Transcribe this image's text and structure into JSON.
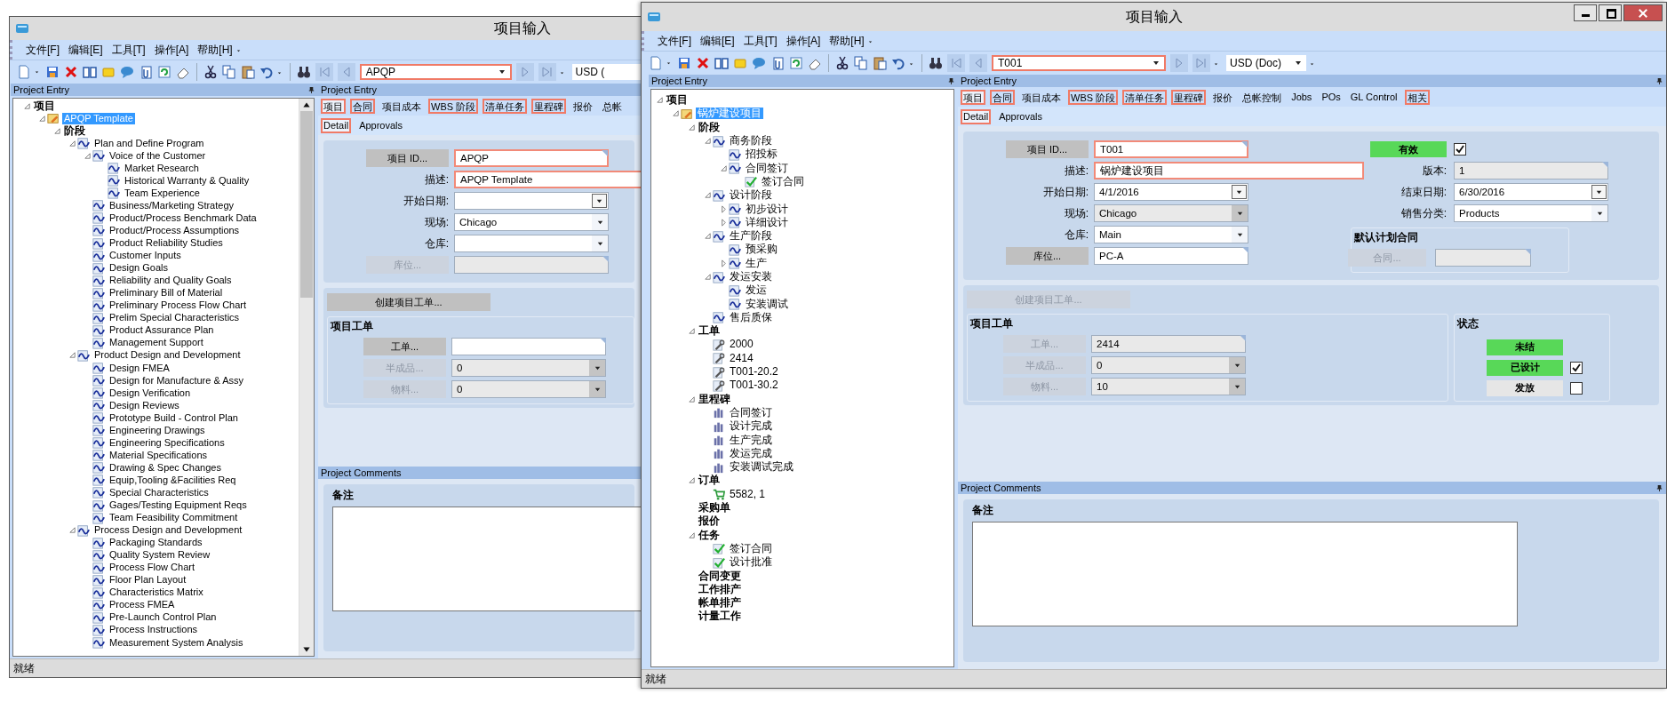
{
  "windows": [
    {
      "title": "项目输入",
      "window_buttons": false,
      "menu": [
        "文件[F]",
        "编辑[E]",
        "工具[T]",
        "操作[A]",
        "帮助[H]"
      ],
      "record": "APQP",
      "currency": "USD (",
      "tree_title": "Project Entry",
      "tree_scrollbar": true,
      "tree": [
        {
          "label": "项目",
          "kind": "root",
          "selected": false,
          "expanded": true,
          "children": [
            {
              "label": "APQP Template",
              "kind": "project",
              "selected": true,
              "expanded": true,
              "children": [
                {
                  "label": "阶段",
                  "kind": "group",
                  "selected": false,
                  "expanded": true,
                  "children": [
                    {
                      "label": "Plan and Define Program",
                      "kind": "phase",
                      "selected": false,
                      "expanded": true,
                      "children": [
                        {
                          "label": "Voice of the Customer",
                          "kind": "phase",
                          "selected": false,
                          "expanded": true,
                          "children": [
                            {
                              "label": "Market Research",
                              "kind": "phase",
                              "selected": false
                            },
                            {
                              "label": "Historical Warranty & Quality",
                              "kind": "phase",
                              "selected": false
                            },
                            {
                              "label": "Team Experience",
                              "kind": "phase",
                              "selected": false
                            }
                          ]
                        },
                        {
                          "label": "Business/Marketing Strategy",
                          "kind": "phase",
                          "selected": false
                        },
                        {
                          "label": "Product/Process Benchmark Data",
                          "kind": "phase",
                          "selected": false
                        },
                        {
                          "label": "Product/Process Assumptions",
                          "kind": "phase",
                          "selected": false
                        },
                        {
                          "label": "Product Reliability Studies",
                          "kind": "phase",
                          "selected": false
                        },
                        {
                          "label": "Customer Inputs",
                          "kind": "phase",
                          "selected": false
                        },
                        {
                          "label": "Design Goals",
                          "kind": "phase",
                          "selected": false
                        },
                        {
                          "label": "Reliability and Quality Goals",
                          "kind": "phase",
                          "selected": false
                        },
                        {
                          "label": "Preliminary Bill of Material",
                          "kind": "phase",
                          "selected": false
                        },
                        {
                          "label": "Preliminary Process Flow Chart",
                          "kind": "phase",
                          "selected": false
                        },
                        {
                          "label": "Prelim Special Characteristics",
                          "kind": "phase",
                          "selected": false
                        },
                        {
                          "label": "Product Assurance Plan",
                          "kind": "phase",
                          "selected": false
                        },
                        {
                          "label": "Management Support",
                          "kind": "phase",
                          "selected": false
                        }
                      ]
                    },
                    {
                      "label": "Product Design and Development",
                      "kind": "phase",
                      "selected": false,
                      "expanded": true,
                      "children": [
                        {
                          "label": "Design FMEA",
                          "kind": "phase",
                          "selected": false
                        },
                        {
                          "label": "Design for Manufacture & Assy",
                          "kind": "phase",
                          "selected": false
                        },
                        {
                          "label": "Design Verification",
                          "kind": "phase",
                          "selected": false
                        },
                        {
                          "label": "Design Reviews",
                          "kind": "phase",
                          "selected": false
                        },
                        {
                          "label": "Prototype Build - Control Plan",
                          "kind": "phase",
                          "selected": false
                        },
                        {
                          "label": "Engineering Drawings",
                          "kind": "phase",
                          "selected": false
                        },
                        {
                          "label": "Engineering Specifications",
                          "kind": "phase",
                          "selected": false
                        },
                        {
                          "label": "Material Specifications",
                          "kind": "phase",
                          "selected": false
                        },
                        {
                          "label": "Drawing & Spec Changes",
                          "kind": "phase",
                          "selected": false
                        },
                        {
                          "label": "Equip,Tooling &Facilities Req",
                          "kind": "phase",
                          "selected": false
                        },
                        {
                          "label": "Special Characteristics",
                          "kind": "phase",
                          "selected": false
                        },
                        {
                          "label": "Gages/Testing Equipment Reqs",
                          "kind": "phase",
                          "selected": false
                        },
                        {
                          "label": "Team Feasibility Commitment",
                          "kind": "phase",
                          "selected": false
                        }
                      ]
                    },
                    {
                      "label": "Process Design and Development",
                      "kind": "phase",
                      "selected": false,
                      "expanded": true,
                      "children": [
                        {
                          "label": "Packaging Standards",
                          "kind": "phase",
                          "selected": false
                        },
                        {
                          "label": "Quality System Review",
                          "kind": "phase",
                          "selected": false
                        },
                        {
                          "label": "Process Flow Chart",
                          "kind": "phase",
                          "selected": false
                        },
                        {
                          "label": "Floor Plan Layout",
                          "kind": "phase",
                          "selected": false
                        },
                        {
                          "label": "Characteristics Matrix",
                          "kind": "phase",
                          "selected": false
                        },
                        {
                          "label": "Process FMEA",
                          "kind": "phase",
                          "selected": false
                        },
                        {
                          "label": "Pre-Launch Control Plan",
                          "kind": "phase",
                          "selected": false
                        },
                        {
                          "label": "Process Instructions",
                          "kind": "phase",
                          "selected": false
                        },
                        {
                          "label": "Measurement System Analysis",
                          "kind": "phase",
                          "selected": false
                        }
                      ]
                    }
                  ]
                }
              ]
            }
          ]
        }
      ],
      "form_title": "Project Entry",
      "tabs": [
        {
          "label": "项目",
          "selected": true,
          "flagged": true
        },
        {
          "label": "合同",
          "selected": false,
          "flagged": true
        },
        {
          "label": "项目成本",
          "selected": false,
          "flagged": false
        },
        {
          "label": "WBS 阶段",
          "selected": false,
          "flagged": true
        },
        {
          "label": "清单任务",
          "selected": false,
          "flagged": true
        },
        {
          "label": "里程碑",
          "selected": false,
          "flagged": true
        },
        {
          "label": "报价",
          "selected": false,
          "flagged": false
        },
        {
          "label": "总帐",
          "selected": false,
          "flagged": false
        }
      ],
      "subtabs": [
        {
          "label": "Detail",
          "selected": true,
          "flagged": true
        },
        {
          "label": "Approvals",
          "selected": false,
          "flagged": false
        }
      ],
      "fields": [
        {
          "button": "项目 ID...",
          "kind": "text",
          "value": "APQP",
          "required": true,
          "disabled": false
        },
        {
          "label": "描述:",
          "kind": "long_text",
          "value": "APQP Template",
          "required": true,
          "disabled": false
        },
        {
          "label": "开始日期:",
          "kind": "date",
          "required": false,
          "disabled": false
        },
        {
          "label": "现场:",
          "kind": "combo",
          "value": "Chicago",
          "required": false,
          "disabled": false
        },
        {
          "label": "仓库:",
          "kind": "combo",
          "required": false,
          "disabled": false
        },
        {
          "button": "库位...",
          "kind": "text",
          "required": false,
          "disabled": true
        }
      ],
      "create_button": {
        "label": "创建项目工单...",
        "disabled": false
      },
      "work_order_group": {
        "title": "项目工单",
        "fields": [
          {
            "button": "工单...",
            "kind": "text",
            "required": false,
            "disabled": false
          },
          {
            "button": "半成品...",
            "kind": "combo",
            "value": "0",
            "required": false,
            "disabled": true
          },
          {
            "button": "物料...",
            "kind": "combo",
            "value": "0",
            "required": false,
            "disabled": true
          }
        ]
      },
      "comments_title": "Project Comments",
      "notes_label": "备注",
      "status": "就绪"
    },
    {
      "title": "项目输入",
      "window_buttons": true,
      "menu": [
        "文件[F]",
        "编辑[E]",
        "工具[T]",
        "操作[A]",
        "帮助[H]"
      ],
      "record": "T001",
      "currency": "USD (Doc)",
      "tree_title": "Project Entry",
      "tree_scrollbar": false,
      "tree": [
        {
          "label": "项目",
          "kind": "root",
          "selected": false,
          "expanded": true,
          "children": [
            {
              "label": "锅炉建设项目",
              "kind": "project",
              "selected": true,
              "expanded": true,
              "children": [
                {
                  "label": "阶段",
                  "kind": "group",
                  "selected": false,
                  "expanded": true,
                  "children": [
                    {
                      "label": "商务阶段",
                      "kind": "phase",
                      "selected": false,
                      "expanded": true,
                      "children": [
                        {
                          "label": "招投标",
                          "kind": "phase",
                          "selected": false
                        },
                        {
                          "label": "合同签订",
                          "kind": "phase",
                          "selected": false,
                          "expanded": true,
                          "children": [
                            {
                              "label": "签订合同",
                              "kind": "task",
                              "selected": false
                            }
                          ]
                        }
                      ]
                    },
                    {
                      "label": "设计阶段",
                      "kind": "phase",
                      "selected": false,
                      "expanded": true,
                      "children": [
                        {
                          "label": "初步设计",
                          "kind": "phase",
                          "selected": false,
                          "expanded": false
                        },
                        {
                          "label": "详细设计",
                          "kind": "phase",
                          "selected": false,
                          "expanded": false
                        }
                      ]
                    },
                    {
                      "label": "生产阶段",
                      "kind": "phase",
                      "selected": false,
                      "expanded": true,
                      "children": [
                        {
                          "label": "预采购",
                          "kind": "phase",
                          "selected": false
                        },
                        {
                          "label": "生产",
                          "kind": "phase",
                          "selected": false,
                          "expanded": false
                        }
                      ]
                    },
                    {
                      "label": "发运安装",
                      "kind": "phase",
                      "selected": false,
                      "expanded": true,
                      "children": [
                        {
                          "label": "发运",
                          "kind": "phase",
                          "selected": false
                        },
                        {
                          "label": "安装调试",
                          "kind": "phase",
                          "selected": false
                        }
                      ]
                    },
                    {
                      "label": "售后质保",
                      "kind": "phase",
                      "selected": false
                    }
                  ]
                },
                {
                  "label": "工单",
                  "kind": "group",
                  "selected": false,
                  "expanded": true,
                  "children": [
                    {
                      "label": "2000",
                      "kind": "work_order",
                      "selected": false
                    },
                    {
                      "label": "2414",
                      "kind": "work_order",
                      "selected": false
                    },
                    {
                      "label": "T001-20.2",
                      "kind": "work_order",
                      "selected": false
                    },
                    {
                      "label": "T001-30.2",
                      "kind": "work_order",
                      "selected": false
                    }
                  ]
                },
                {
                  "label": "里程碑",
                  "kind": "group",
                  "selected": false,
                  "expanded": true,
                  "children": [
                    {
                      "label": "合同签订",
                      "kind": "milestone",
                      "selected": false
                    },
                    {
                      "label": "设计完成",
                      "kind": "milestone",
                      "selected": false
                    },
                    {
                      "label": "生产完成",
                      "kind": "milestone",
                      "selected": false
                    },
                    {
                      "label": "发运完成",
                      "kind": "milestone",
                      "selected": false
                    },
                    {
                      "label": "安装调试完成",
                      "kind": "milestone",
                      "selected": false
                    }
                  ]
                },
                {
                  "label": "订单",
                  "kind": "group",
                  "selected": false,
                  "expanded": true,
                  "children": [
                    {
                      "label": "5582, 1",
                      "kind": "order",
                      "selected": false
                    }
                  ]
                },
                {
                  "label": "采购单",
                  "kind": "group",
                  "selected": false
                },
                {
                  "label": "报价",
                  "kind": "group",
                  "selected": false
                },
                {
                  "label": "任务",
                  "kind": "group",
                  "selected": false,
                  "expanded": true,
                  "children": [
                    {
                      "label": "签订合同",
                      "kind": "task",
                      "selected": false
                    },
                    {
                      "label": "设计批准",
                      "kind": "task",
                      "selected": false
                    }
                  ]
                },
                {
                  "label": "合同变更",
                  "kind": "group",
                  "selected": false
                },
                {
                  "label": "工作排产",
                  "kind": "group",
                  "selected": false
                },
                {
                  "label": "帐单排产",
                  "kind": "group",
                  "selected": false
                },
                {
                  "label": "计量工作",
                  "kind": "group",
                  "selected": false
                }
              ]
            }
          ]
        }
      ],
      "form_title": "Project Entry",
      "tabs": [
        {
          "label": "项目",
          "selected": true,
          "flagged": true
        },
        {
          "label": "合同",
          "selected": false,
          "flagged": true
        },
        {
          "label": "项目成本",
          "selected": false,
          "flagged": false
        },
        {
          "label": "WBS 阶段",
          "selected": false,
          "flagged": true
        },
        {
          "label": "清单任务",
          "selected": false,
          "flagged": true
        },
        {
          "label": "里程碑",
          "selected": false,
          "flagged": true
        },
        {
          "label": "报价",
          "selected": false,
          "flagged": false
        },
        {
          "label": "总帐控制",
          "selected": false,
          "flagged": false
        },
        {
          "label": "Jobs",
          "selected": false,
          "flagged": false
        },
        {
          "label": "POs",
          "selected": false,
          "flagged": false
        },
        {
          "label": "GL Control",
          "selected": false,
          "flagged": false
        },
        {
          "label": "相关",
          "selected": false,
          "flagged": true
        }
      ],
      "subtabs": [
        {
          "label": "Detail",
          "selected": true,
          "flagged": true
        },
        {
          "label": "Approvals",
          "selected": false,
          "flagged": false
        }
      ],
      "fields": [
        {
          "button": "项目 ID...",
          "kind": "text",
          "value": "T001",
          "required": true,
          "disabled": false
        },
        {
          "label": "描述:",
          "kind": "long_text",
          "value": "锅炉建设项目",
          "required": true,
          "disabled": false
        },
        {
          "label": "开始日期:",
          "kind": "date",
          "value": "4/1/2016",
          "required": false,
          "disabled": false
        },
        {
          "label": "现场:",
          "kind": "combo",
          "value": "Chicago",
          "required": false,
          "disabled": true
        },
        {
          "label": "仓库:",
          "kind": "combo",
          "value": "Main",
          "required": false,
          "disabled": false
        },
        {
          "button": "库位...",
          "kind": "text",
          "value": "PC-A",
          "required": false,
          "disabled": false
        }
      ],
      "active": {
        "label": "有效",
        "on": true,
        "checked": true
      },
      "side_fields": [
        {
          "label": "版本:",
          "kind": "text",
          "value": "1",
          "required": false,
          "disabled": true
        },
        {
          "label": "结束日期:",
          "kind": "date",
          "value": "6/30/2016",
          "required": false,
          "disabled": false
        },
        {
          "label": "销售分类:",
          "kind": "combo",
          "value": "Products",
          "required": false,
          "disabled": false
        }
      ],
      "contract_group": {
        "title": "默认计划合同",
        "fields": [
          {
            "button": "合同...",
            "kind": "text",
            "required": false,
            "disabled": true
          }
        ]
      },
      "create_button": {
        "label": "创建项目工单...",
        "disabled": true
      },
      "work_order_group": {
        "title": "项目工单",
        "fields": [
          {
            "button": "工单...",
            "kind": "text",
            "value": "2414",
            "required": false,
            "disabled": true
          },
          {
            "button": "半成品...",
            "kind": "combo",
            "value": "0",
            "required": false,
            "disabled": true
          },
          {
            "button": "物料...",
            "kind": "combo",
            "value": "10",
            "required": false,
            "disabled": true
          }
        ]
      },
      "status_group": {
        "title": "状态",
        "items": [
          {
            "label": "未结",
            "on": true
          },
          {
            "label": "已设计",
            "on": true,
            "checked": true
          },
          {
            "label": "发放",
            "on": false,
            "checked": false
          }
        ]
      },
      "comments_title": "Project Comments",
      "notes_label": "备注",
      "status": "就绪"
    }
  ]
}
